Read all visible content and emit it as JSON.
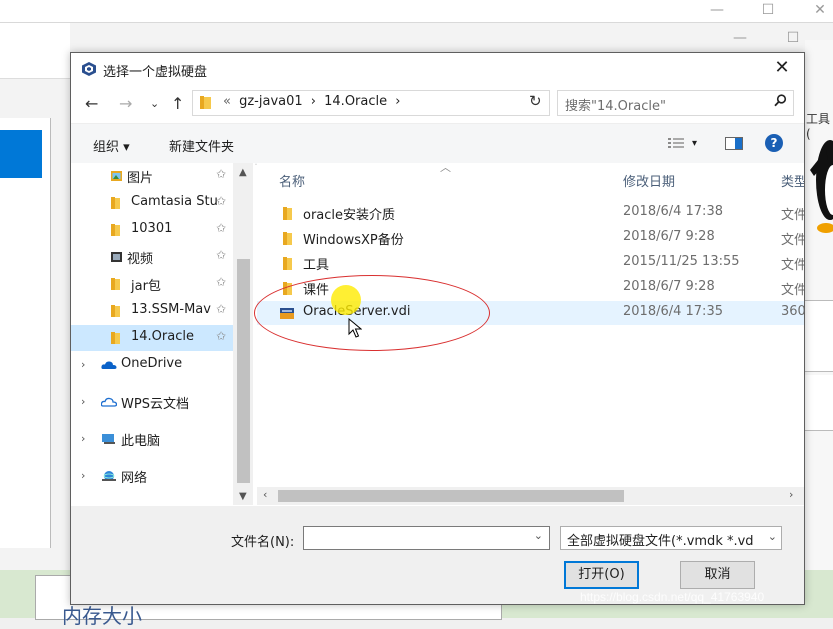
{
  "window": {
    "minimize": "—",
    "maximize": "☐",
    "close": "✕"
  },
  "background": {
    "memory_label": "内存大小",
    "tools_label": "工具("
  },
  "dialog": {
    "title": "选择一个虚拟硬盘",
    "close": "✕",
    "address": {
      "overflow": "«",
      "crumbs": [
        "gz-java01",
        "›",
        "14.Oracle",
        "›"
      ]
    },
    "search_placeholder": "搜索\"14.Oracle\"",
    "toolbar": {
      "organize": "组织 ▾",
      "new_folder": "新建文件夹",
      "view_dd": "▾",
      "help": "?"
    },
    "nav_items": [
      {
        "label": "图片",
        "icon": "pictures-icon",
        "pinned": true
      },
      {
        "label": "Camtasia Stu",
        "icon": "folder-icon",
        "pinned": true
      },
      {
        "label": "10301",
        "icon": "folder-icon",
        "pinned": true
      },
      {
        "label": "视频",
        "icon": "videos-icon",
        "pinned": true
      },
      {
        "label": "jar包",
        "icon": "folder-icon",
        "pinned": true
      },
      {
        "label": "13.SSM-Mav",
        "icon": "folder-icon",
        "pinned": true
      },
      {
        "label": "14.Oracle",
        "icon": "folder-icon",
        "pinned": true,
        "selected": true
      },
      {
        "label": "OneDrive",
        "icon": "onedrive-icon",
        "expandable": true
      },
      {
        "label": "WPS云文档",
        "icon": "wps-cloud-icon",
        "expandable": true
      },
      {
        "label": "此电脑",
        "icon": "this-pc-icon",
        "expandable": true
      },
      {
        "label": "网络",
        "icon": "network-icon",
        "expandable": true
      }
    ],
    "columns": {
      "name": "名称",
      "date": "修改日期",
      "type": "类型"
    },
    "files": [
      {
        "name": "oracle安装介质",
        "date": "2018/6/4 17:38",
        "type": "文件",
        "icon": "folder-icon"
      },
      {
        "name": "WindowsXP备份",
        "date": "2018/6/7 9:28",
        "type": "文件",
        "icon": "folder-icon"
      },
      {
        "name": "工具",
        "date": "2015/11/25 13:55",
        "type": "文件",
        "icon": "folder-icon"
      },
      {
        "name": "课件",
        "date": "2018/6/7 9:28",
        "type": "文件",
        "icon": "folder-icon"
      },
      {
        "name": "OracleServer.vdi",
        "date": "2018/6/4 17:35",
        "type": "360",
        "icon": "vdi-file-icon",
        "selected": true
      }
    ],
    "filename_label": "文件名(N):",
    "filename_value": "",
    "filter": "全部虚拟硬盘文件(*.vmdk *.vd",
    "open_button": "打开(O)",
    "cancel_button": "取消"
  },
  "watermark": "https://blog.csdn.net/qq_41763940",
  "colors": {
    "accent": "#0078d7",
    "selection": "#cce8ff",
    "folder": "#f3c14a",
    "annotation": "#d93030",
    "cursor_highlight": "#ffeb00"
  }
}
